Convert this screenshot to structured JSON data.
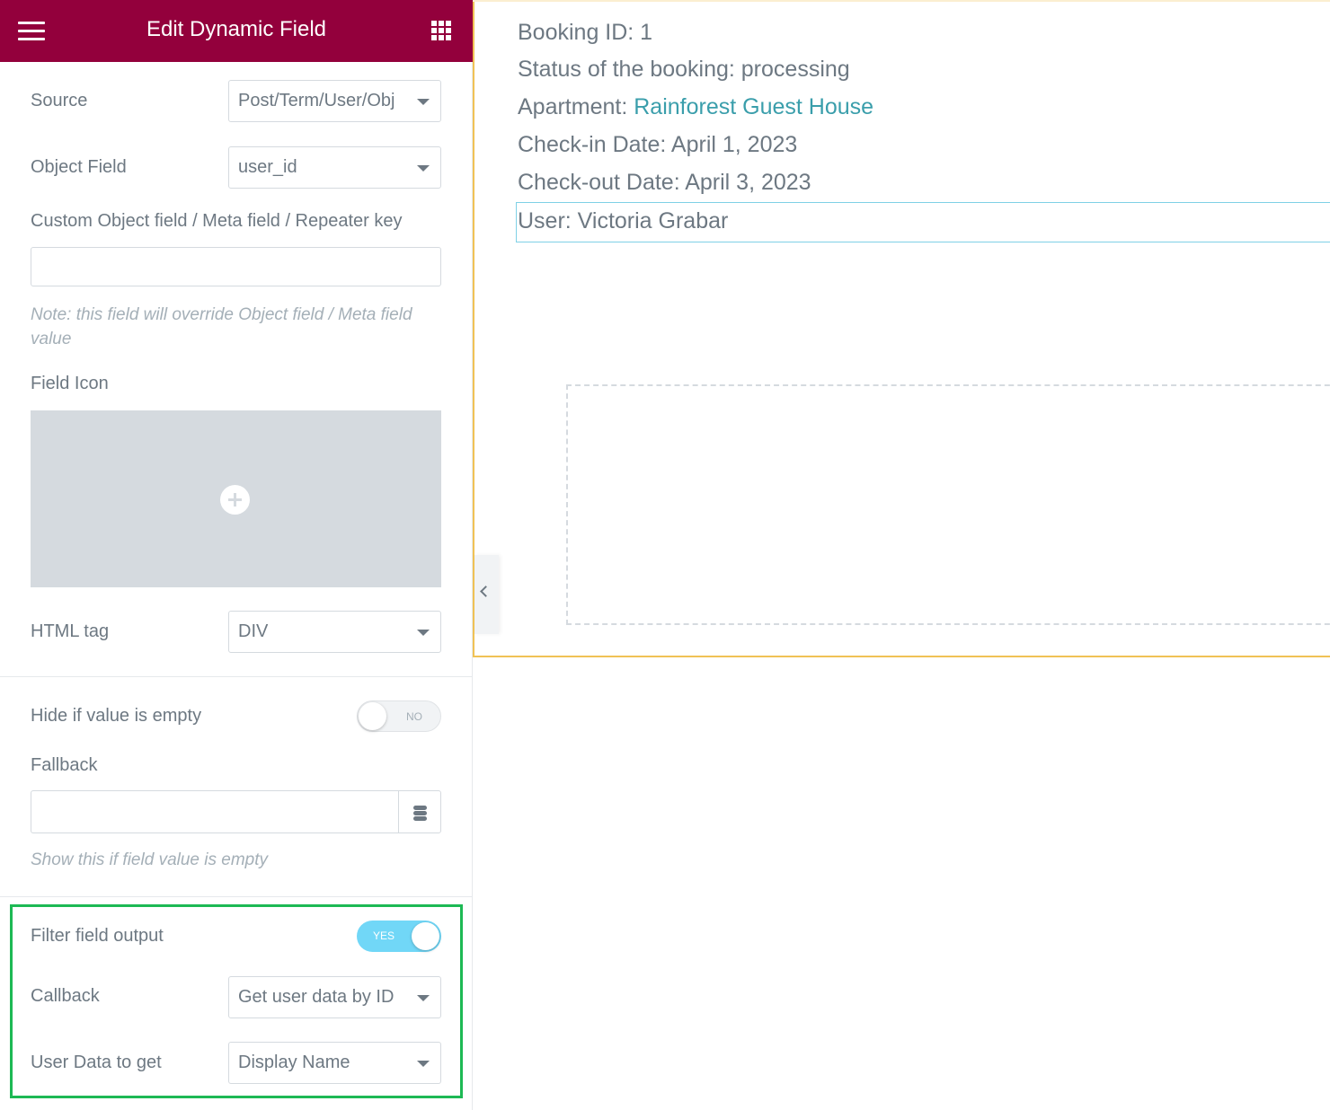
{
  "panel": {
    "title": "Edit Dynamic Field",
    "header_color": "#93003c",
    "source": {
      "label": "Source",
      "value": "Post/Term/User/Obj"
    },
    "object_field": {
      "label": "Object Field",
      "value": "user_id"
    },
    "custom_field": {
      "label": "Custom Object field / Meta field / Repeater key",
      "value": "",
      "note": "Note: this field will override Object field / Meta field value"
    },
    "field_icon": {
      "label": "Field Icon"
    },
    "html_tag": {
      "label": "HTML tag",
      "value": "DIV"
    },
    "hide_empty": {
      "label": "Hide if value is empty",
      "toggle_text": "NO",
      "state": false
    },
    "fallback": {
      "label": "Fallback",
      "value": "",
      "note": "Show this if field value is empty"
    },
    "filter_output": {
      "label": "Filter field output",
      "toggle_text": "YES",
      "state": true
    },
    "callback": {
      "label": "Callback",
      "value": "Get user data by ID"
    },
    "user_data": {
      "label": "User Data to get",
      "value": "Display Name"
    },
    "highlight_color": "#1db954"
  },
  "preview": {
    "booking_id": "Booking ID: 1",
    "status": "Status of the booking: processing",
    "apartment_label": "Apartment: ",
    "apartment_link": "Rainforest Guest House",
    "checkin": "Check-in Date: April 1, 2023",
    "checkout": "Check-out Date: April 3, 2023",
    "user": "User: Victoria Grabar",
    "link_color": "#3a9eab",
    "section_border_color": "#f0c255"
  }
}
